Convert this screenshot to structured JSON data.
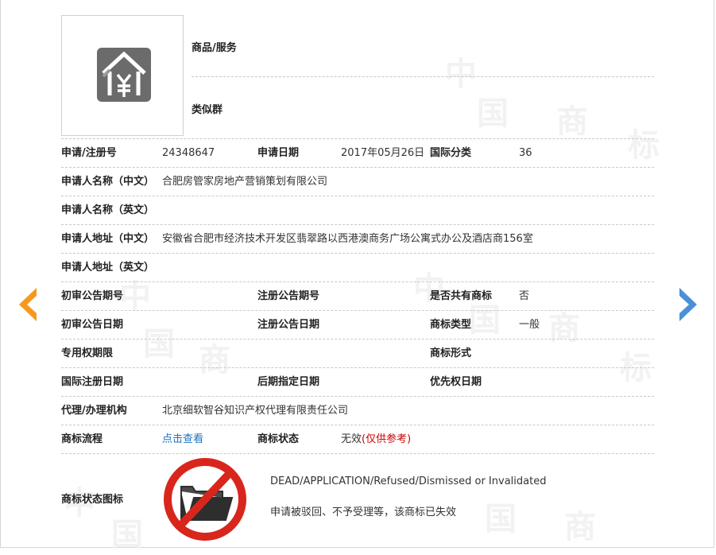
{
  "header": {
    "goods_label": "商品/服务",
    "similar_group_label": "类似群"
  },
  "info": {
    "reg_no_label": "申请/注册号",
    "reg_no": "24348647",
    "apply_date_label": "申请日期",
    "apply_date": "2017年05月26日",
    "intl_class_label": "国际分类",
    "intl_class": "36",
    "applicant_cn_label": "申请人名称（中文）",
    "applicant_cn": "合肥房管家房地产营销策划有限公司",
    "applicant_en_label": "申请人名称（英文）",
    "applicant_en": "",
    "address_cn_label": "申请人地址（中文）",
    "address_cn": "安徽省合肥市经济技术开发区翡翠路以西港澳商务广场公寓式办公及酒店商156室",
    "address_en_label": "申请人地址（英文）",
    "address_en": "",
    "prelim_pub_no_label": "初审公告期号",
    "prelim_pub_no": "",
    "reg_pub_no_label": "注册公告期号",
    "reg_pub_no": "",
    "shared_label": "是否共有商标",
    "shared": "否",
    "prelim_pub_date_label": "初审公告日期",
    "prelim_pub_date": "",
    "reg_pub_date_label": "注册公告日期",
    "reg_pub_date": "",
    "tm_type_label": "商标类型",
    "tm_type": "一般",
    "exclusive_period_label": "专用权期限",
    "exclusive_period": "",
    "tm_form_label": "商标形式",
    "tm_form": "",
    "intl_reg_date_label": "国际注册日期",
    "intl_reg_date": "",
    "later_date_label": "后期指定日期",
    "later_date": "",
    "priority_date_label": "优先权日期",
    "priority_date": "",
    "agent_label": "代理/办理机构",
    "agent": "北京细软智谷知识产权代理有限责任公司",
    "process_label": "商标流程",
    "process_link": "点击查看",
    "status_label": "商标状态",
    "status_value": "无效",
    "status_note": "(仅供参考)",
    "status_icon_label": "商标状态图标",
    "status_en": "DEAD/APPLICATION/Refused/Dismissed or Invalidated",
    "status_cn": "申请被驳回、不予受理等，该商标已失效"
  },
  "colors": {
    "prev_arrow": "#f39a1e",
    "next_arrow": "#4a90d9",
    "link": "#1a73c4",
    "note_red": "#cc0000",
    "logo_gray": "#6b6b6b",
    "forbidden_red": "#d9261c"
  },
  "icons": {
    "logo": "house-yen-icon",
    "status": "forbidden-folder-icon",
    "prev": "chevron-left-icon",
    "next": "chevron-right-icon"
  }
}
